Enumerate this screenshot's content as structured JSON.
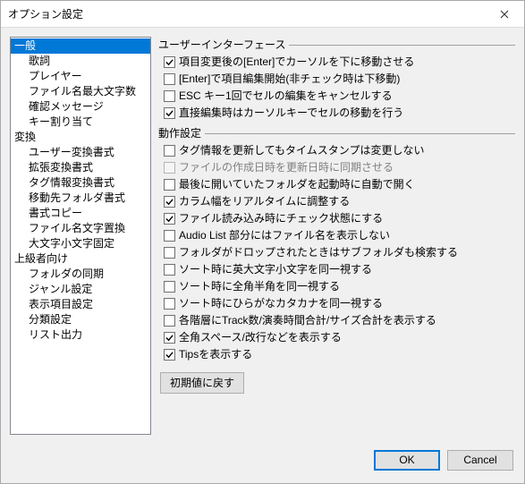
{
  "window": {
    "title": "オプション設定"
  },
  "sidebar": {
    "items": [
      {
        "label": "一般",
        "level": 0,
        "selected": true
      },
      {
        "label": "歌詞",
        "level": 1
      },
      {
        "label": "プレイヤー",
        "level": 1
      },
      {
        "label": "ファイル名最大文字数",
        "level": 1
      },
      {
        "label": "確認メッセージ",
        "level": 1
      },
      {
        "label": "キー割り当て",
        "level": 1
      },
      {
        "label": "変換",
        "level": 0
      },
      {
        "label": "ユーザー変換書式",
        "level": 1
      },
      {
        "label": "拡張変換書式",
        "level": 1
      },
      {
        "label": "タグ情報変換書式",
        "level": 1
      },
      {
        "label": "移動先フォルダ書式",
        "level": 1
      },
      {
        "label": "書式コピー",
        "level": 1
      },
      {
        "label": "ファイル名文字置換",
        "level": 1
      },
      {
        "label": "大文字小文字固定",
        "level": 1
      },
      {
        "label": "上級者向け",
        "level": 0
      },
      {
        "label": "フォルダの同期",
        "level": 1
      },
      {
        "label": "ジャンル設定",
        "level": 1
      },
      {
        "label": "表示項目設定",
        "level": 1
      },
      {
        "label": "分類設定",
        "level": 1
      },
      {
        "label": "リスト出力",
        "level": 1
      }
    ]
  },
  "groups": {
    "ui": {
      "title": "ユーザーインターフェース",
      "items": [
        {
          "label": "項目変更後の[Enter]でカーソルを下に移動させる",
          "checked": true
        },
        {
          "label": "[Enter]で項目編集開始(非チェック時は下移動)",
          "checked": false
        },
        {
          "label": "ESC キー1回でセルの編集をキャンセルする",
          "checked": false
        },
        {
          "label": "直接編集時はカーソルキーでセルの移動を行う",
          "checked": true
        }
      ]
    },
    "behavior": {
      "title": "動作設定",
      "items": [
        {
          "label": "タグ情報を更新してもタイムスタンプは変更しない",
          "checked": false
        },
        {
          "label": "ファイルの作成日時を更新日時に同期させる",
          "checked": false,
          "disabled": true
        },
        {
          "label": "最後に開いていたフォルダを起動時に自動で開く",
          "checked": false
        },
        {
          "label": "カラム幅をリアルタイムに調整する",
          "checked": true
        },
        {
          "label": "ファイル読み込み時にチェック状態にする",
          "checked": true
        },
        {
          "label": "Audio List 部分にはファイル名を表示しない",
          "checked": false
        },
        {
          "label": "フォルダがドロップされたときはサブフォルダも検索する",
          "checked": false
        },
        {
          "label": "ソート時に英大文字小文字を同一視する",
          "checked": false
        },
        {
          "label": "ソート時に全角半角を同一視する",
          "checked": false
        },
        {
          "label": "ソート時にひらがなカタカナを同一視する",
          "checked": false
        },
        {
          "label": "各階層にTrack数/演奏時間合計/サイズ合計を表示する",
          "checked": false
        },
        {
          "label": "全角スペース/改行などを表示する",
          "checked": true
        },
        {
          "label": "Tipsを表示する",
          "checked": true
        }
      ]
    }
  },
  "buttons": {
    "reset": "初期値に戻す",
    "ok": "OK",
    "cancel": "Cancel"
  }
}
